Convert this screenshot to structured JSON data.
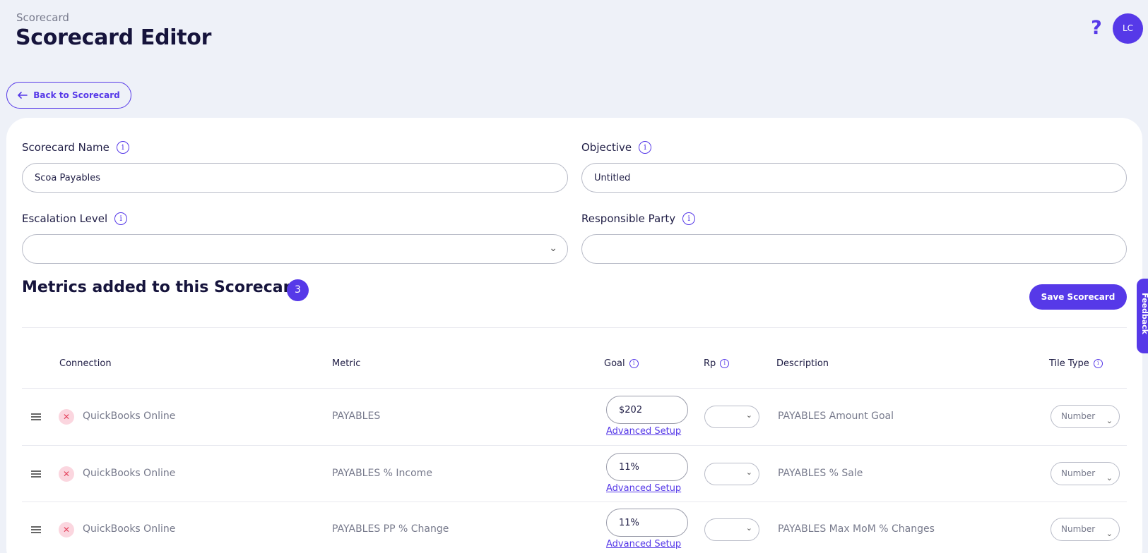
{
  "header": {
    "breadcrumb": "Scorecard",
    "title": "Scorecard Editor",
    "help_glyph": "?",
    "avatar_initials": "LC"
  },
  "back_button": {
    "label": "Back to Scorecard",
    "icon": "arrow-left-icon"
  },
  "form": {
    "scorecard_name": {
      "label": "Scorecard Name",
      "value": "Scoa Payables"
    },
    "objective": {
      "label": "Objective",
      "value": "Untitled"
    },
    "escalation_level": {
      "label": "Escalation Level",
      "value": ""
    },
    "responsible_party": {
      "label": "Responsible Party",
      "value": ""
    },
    "info_glyph": "i"
  },
  "metrics": {
    "title": "Metrics added to this Scorecard",
    "count": "3",
    "save_label": "Save Scorecard",
    "columns": {
      "connection": "Connection",
      "metric": "Metric",
      "goal": "Goal",
      "rp": "Rp",
      "description": "Description",
      "tile_type": "Tile Type"
    },
    "advanced_label": "Advanced Setup",
    "rows": [
      {
        "connection": "QuickBooks Online",
        "metric": "PAYABLES",
        "goal": "$202",
        "rp": "",
        "description": "PAYABLES Amount Goal",
        "tile_type": "Number"
      },
      {
        "connection": "QuickBooks Online",
        "metric": "PAYABLES % Income",
        "goal": "11%",
        "rp": "",
        "description": "PAYABLES % Sale",
        "tile_type": "Number"
      },
      {
        "connection": "QuickBooks Online",
        "metric": "PAYABLES PP % Change",
        "goal": "11%",
        "rp": "",
        "description": "PAYABLES Max MoM % Changes",
        "tile_type": "Number"
      }
    ]
  },
  "feedback_tab": {
    "label": "Feedback"
  },
  "colors": {
    "accent": "#5639e8",
    "background": "#eef1f8",
    "remove": "#e4455f"
  }
}
